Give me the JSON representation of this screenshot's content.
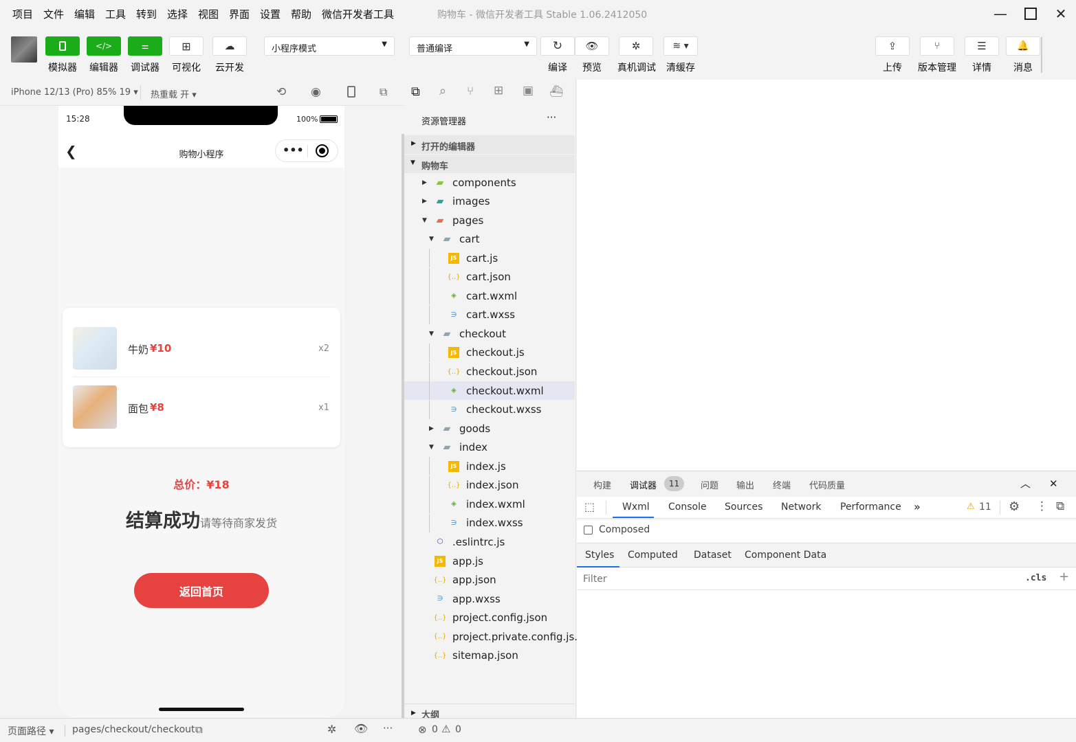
{
  "menu": [
    "项目",
    "文件",
    "编辑",
    "工具",
    "转到",
    "选择",
    "视图",
    "界面",
    "设置",
    "帮助",
    "微信开发者工具"
  ],
  "window_title": "购物车 - 微信开发者工具 Stable 1.06.2412050",
  "toolbar": {
    "simulator": "模拟器",
    "editor": "编辑器",
    "debugger": "调试器",
    "visual": "可视化",
    "cloud": "云开发",
    "mode_select": "小程序模式",
    "compile_select": "普通编译",
    "compile": "编译",
    "preview": "预览",
    "remote_debug": "真机调试",
    "clear_cache": "清缓存",
    "upload": "上传",
    "version": "版本管理",
    "details": "详情",
    "messages": "消息"
  },
  "simulator": {
    "device": "iPhone 12/13 (Pro) 85% 19 ▾",
    "hot_reload": "热重载 开 ▾"
  },
  "phone": {
    "time": "15:28",
    "battery": "100%",
    "nav_title": "购物小程序",
    "items": [
      {
        "name": "牛奶",
        "price": "¥10",
        "qty": "x2"
      },
      {
        "name": "面包",
        "price": "¥8",
        "qty": "x1"
      }
    ],
    "total_label": "总价：",
    "total_value": "¥18",
    "success_big": "结算成功",
    "success_small": "请等待商家发货",
    "back_button": "返回首页"
  },
  "explorer": {
    "title": "资源管理器",
    "open_editors": "打开的编辑器",
    "project": "购物车",
    "outline": "大纲",
    "tree": [
      {
        "name": "components",
        "type": "folder-green",
        "depth": 0,
        "arrow": "closed"
      },
      {
        "name": "images",
        "type": "folder-teal",
        "depth": 0,
        "arrow": "closed"
      },
      {
        "name": "pages",
        "type": "folder-red",
        "depth": 0,
        "arrow": "open"
      },
      {
        "name": "cart",
        "type": "folder",
        "depth": 1,
        "arrow": "open"
      },
      {
        "name": "cart.js",
        "type": "js",
        "depth": 2
      },
      {
        "name": "cart.json",
        "type": "json",
        "depth": 2
      },
      {
        "name": "cart.wxml",
        "type": "wxml",
        "depth": 2
      },
      {
        "name": "cart.wxss",
        "type": "wxss",
        "depth": 2
      },
      {
        "name": "checkout",
        "type": "folder",
        "depth": 1,
        "arrow": "open"
      },
      {
        "name": "checkout.js",
        "type": "js",
        "depth": 2
      },
      {
        "name": "checkout.json",
        "type": "json",
        "depth": 2
      },
      {
        "name": "checkout.wxml",
        "type": "wxml",
        "depth": 2,
        "selected": true
      },
      {
        "name": "checkout.wxss",
        "type": "wxss",
        "depth": 2
      },
      {
        "name": "goods",
        "type": "folder",
        "depth": 1,
        "arrow": "closed"
      },
      {
        "name": "index",
        "type": "folder",
        "depth": 1,
        "arrow": "open"
      },
      {
        "name": "index.js",
        "type": "js",
        "depth": 2
      },
      {
        "name": "index.json",
        "type": "json",
        "depth": 2
      },
      {
        "name": "index.wxml",
        "type": "wxml",
        "depth": 2
      },
      {
        "name": "index.wxss",
        "type": "wxss",
        "depth": 2
      },
      {
        "name": ".eslintrc.js",
        "type": "eslint",
        "depth": 0
      },
      {
        "name": "app.js",
        "type": "js",
        "depth": 0
      },
      {
        "name": "app.json",
        "type": "json",
        "depth": 0
      },
      {
        "name": "app.wxss",
        "type": "wxss",
        "depth": 0
      },
      {
        "name": "project.config.json",
        "type": "json",
        "depth": 0
      },
      {
        "name": "project.private.config.js...",
        "type": "json",
        "depth": 0
      },
      {
        "name": "sitemap.json",
        "type": "json",
        "depth": 0
      }
    ]
  },
  "devtools": {
    "top_tabs": [
      "构建",
      "调试器",
      "问题",
      "输出",
      "终端",
      "代码质量"
    ],
    "debugger_badge": "11",
    "panel_tabs": [
      "Wxml",
      "Console",
      "Sources",
      "Network",
      "Performance"
    ],
    "warnings": "11",
    "composed": "Composed",
    "style_tabs": [
      "Styles",
      "Computed",
      "Dataset",
      "Component Data"
    ],
    "filter_placeholder": "Filter",
    "cls": ".cls"
  },
  "statusbar": {
    "path_label": "页面路径 ▾",
    "path": "pages/checkout/checkout",
    "errors": "0",
    "warnings": "0"
  },
  "colors": {
    "green": "#1aad19",
    "red": "#e64340",
    "selected_row": "#e4e6f1"
  }
}
